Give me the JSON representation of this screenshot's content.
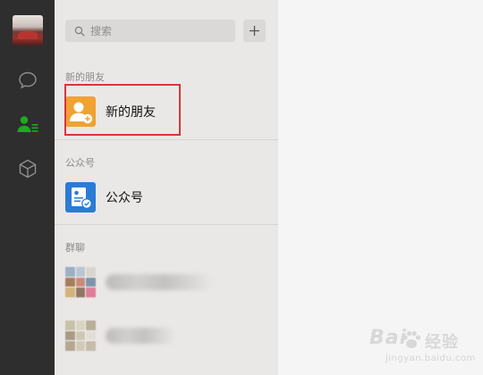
{
  "rail": {
    "items": [
      {
        "name": "chat-icon"
      },
      {
        "name": "contacts-icon",
        "active": true,
        "accent": "#1aad19"
      },
      {
        "name": "cube-icon"
      }
    ]
  },
  "search": {
    "placeholder": "搜索",
    "value": ""
  },
  "add_button": {
    "icon": "plus-icon"
  },
  "sections": {
    "new_friends": {
      "header": "新的朋友",
      "item_label": "新的朋友",
      "icon_color": "#f0a233"
    },
    "official_accounts": {
      "header": "公众号",
      "item_label": "公众号",
      "icon_color": "#2b7bd6"
    },
    "group_chats": {
      "header": "群聊"
    }
  },
  "highlight": {
    "color": "#d9363a"
  },
  "watermark": {
    "brand": "Bai",
    "brand_suffix": "经验",
    "sub": "jingyan.baidu.com"
  }
}
